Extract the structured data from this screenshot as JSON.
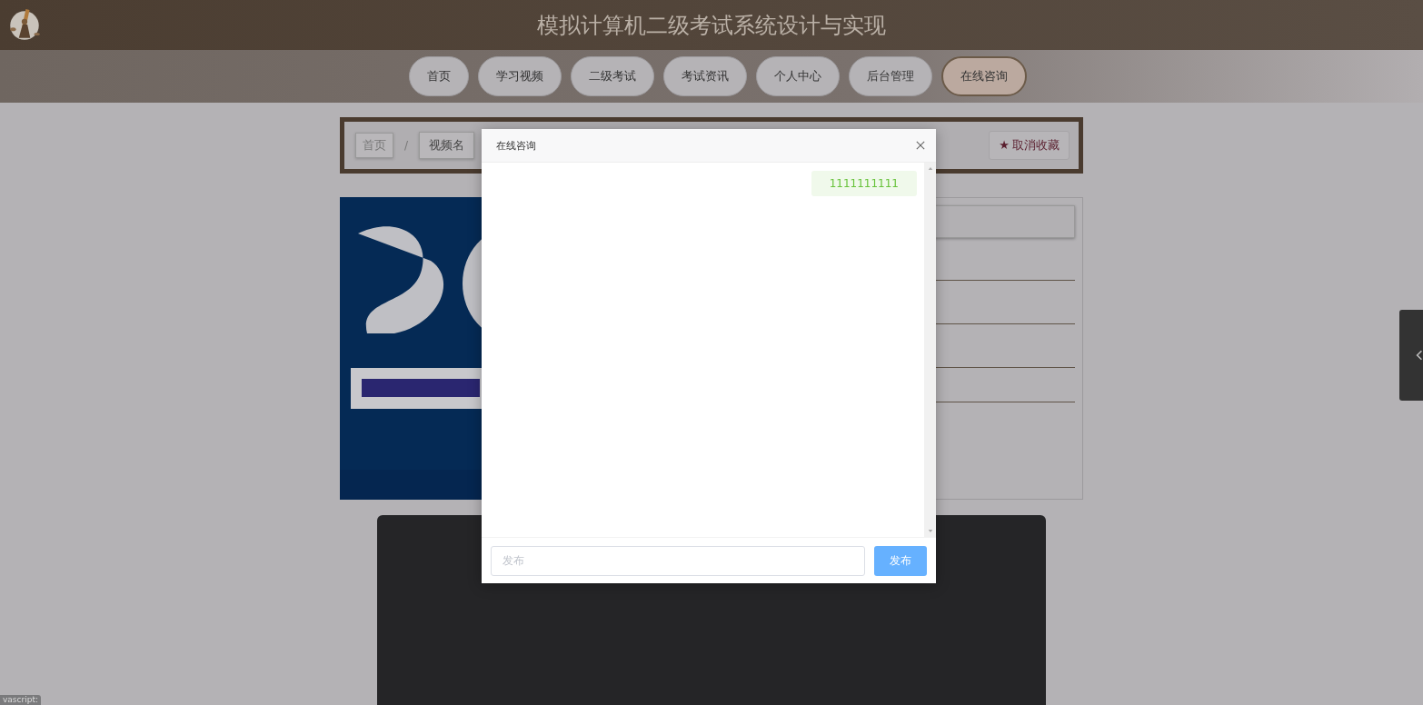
{
  "header": {
    "title": "模拟计算机二级考试系统设计与实现"
  },
  "nav": [
    {
      "label": "首页",
      "selected": false
    },
    {
      "label": "学习视频",
      "selected": false
    },
    {
      "label": "二级考试",
      "selected": false
    },
    {
      "label": "考试资讯",
      "selected": false
    },
    {
      "label": "个人中心",
      "selected": false
    },
    {
      "label": "后台管理",
      "selected": false
    },
    {
      "label": "在线咨询",
      "selected": true
    }
  ],
  "breadcrumb": {
    "items": [
      "首页",
      "视频名"
    ],
    "separator": "/"
  },
  "favorite_button": {
    "icon": "★",
    "label": "取消收藏"
  },
  "dialog": {
    "title": "在线咨询",
    "messages": [
      {
        "kind": "sent",
        "text": "1111111111"
      }
    ],
    "input": {
      "placeholder": "发布"
    },
    "submit": "发布"
  },
  "status_text": "vascript:"
}
